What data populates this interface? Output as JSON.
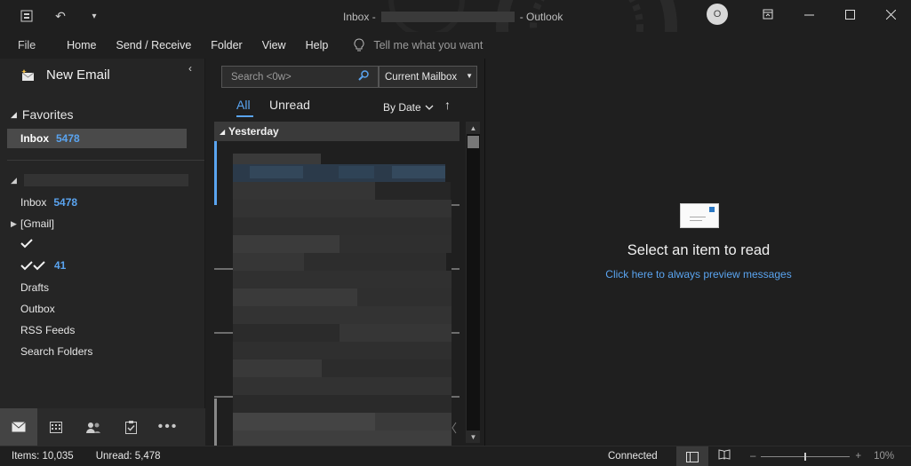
{
  "titlebar": {
    "title_prefix": "Inbox -",
    "title_suffix": "- Outlook",
    "avatar_initial": "O"
  },
  "menu": {
    "items": [
      "File",
      "Home",
      "Send / Receive",
      "Folder",
      "View",
      "Help"
    ],
    "tell_me": "Tell me what you want to do"
  },
  "nav": {
    "new_email": "New Email",
    "favorites_label": "Favorites",
    "favorites_inbox": {
      "label": "Inbox",
      "count": "5478"
    },
    "folders": [
      {
        "label": "Inbox",
        "count": "5478"
      },
      {
        "label": "[Gmail]",
        "count": ""
      },
      {
        "label": "",
        "count": ""
      },
      {
        "label": "",
        "count": "41"
      },
      {
        "label": "Drafts",
        "count": ""
      },
      {
        "label": "Outbox",
        "count": ""
      },
      {
        "label": "RSS Feeds",
        "count": ""
      },
      {
        "label": "Search Folders",
        "count": ""
      }
    ]
  },
  "list": {
    "search_placeholder": "Search <0w>",
    "scope": "Current Mailbox",
    "tab_all": "All",
    "tab_unread": "Unread",
    "sort_label": "By Date",
    "group_label": "Yesterday"
  },
  "reading": {
    "title": "Select an item to read",
    "link": "Click here to always preview messages"
  },
  "status": {
    "items": "Items: 10,035",
    "unread": "Unread: 5,478",
    "connection": "Connected",
    "zoom": "10%"
  },
  "colors": {
    "accent": "#5aa4f0",
    "background": "#1f1f1f"
  }
}
